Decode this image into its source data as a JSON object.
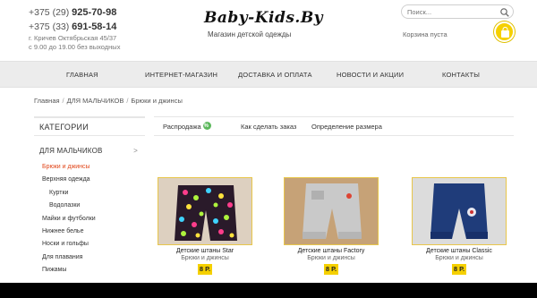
{
  "header": {
    "phone1_prefix": "+375 (29)",
    "phone1_number": "925-70-98",
    "phone2_prefix": "+375 (33)",
    "phone2_number": "691-58-14",
    "address": "г. Кричев Октябрьская 45/37",
    "hours": "с 9.00 до 19.00 без выходных",
    "logo": "Baby-Kids.By",
    "tagline": "Магазин детской одежды",
    "search_placeholder": "Поиск...",
    "cart_text": "Корзина пуста",
    "cart_color": "#f5d000"
  },
  "nav": {
    "items": [
      "ГЛАВНАЯ",
      "ИНТЕРНЕТ-МАГАЗИН",
      "ДОСТАВКА И ОПЛАТА",
      "НОВОСТИ И АКЦИИ",
      "КОНТАКТЫ"
    ]
  },
  "breadcrumb": {
    "items": [
      "Главная",
      "ДЛЯ МАЛЬЧИКОВ",
      "Брюки и джинсы"
    ]
  },
  "sidebar": {
    "heading": "КАТЕГОРИИ",
    "main_category": "ДЛЯ МАЛЬЧИКОВ",
    "main_arrow": ">",
    "items": [
      "Брюки и джинсы",
      "Верхняя одежда",
      "Куртки",
      "Водолазки",
      "Майки и футболки",
      "Нижнее белье",
      "Носки и гольфы",
      "Для плавания",
      "Пижамы"
    ],
    "active_color": "#e1471b"
  },
  "tabs": {
    "items": [
      "Распродажа",
      "Как сделать заказ",
      "Определение размера"
    ]
  },
  "products": [
    {
      "name": "Детские штаны Star",
      "category": "Брюки и джинсы",
      "price": "8 Р."
    },
    {
      "name": "Детские штаны Factory",
      "category": "Брюки и джинсы",
      "price": "8 Р."
    },
    {
      "name": "Детские штаны Classic",
      "category": "Брюки и джинсы",
      "price": "8 Р."
    }
  ]
}
